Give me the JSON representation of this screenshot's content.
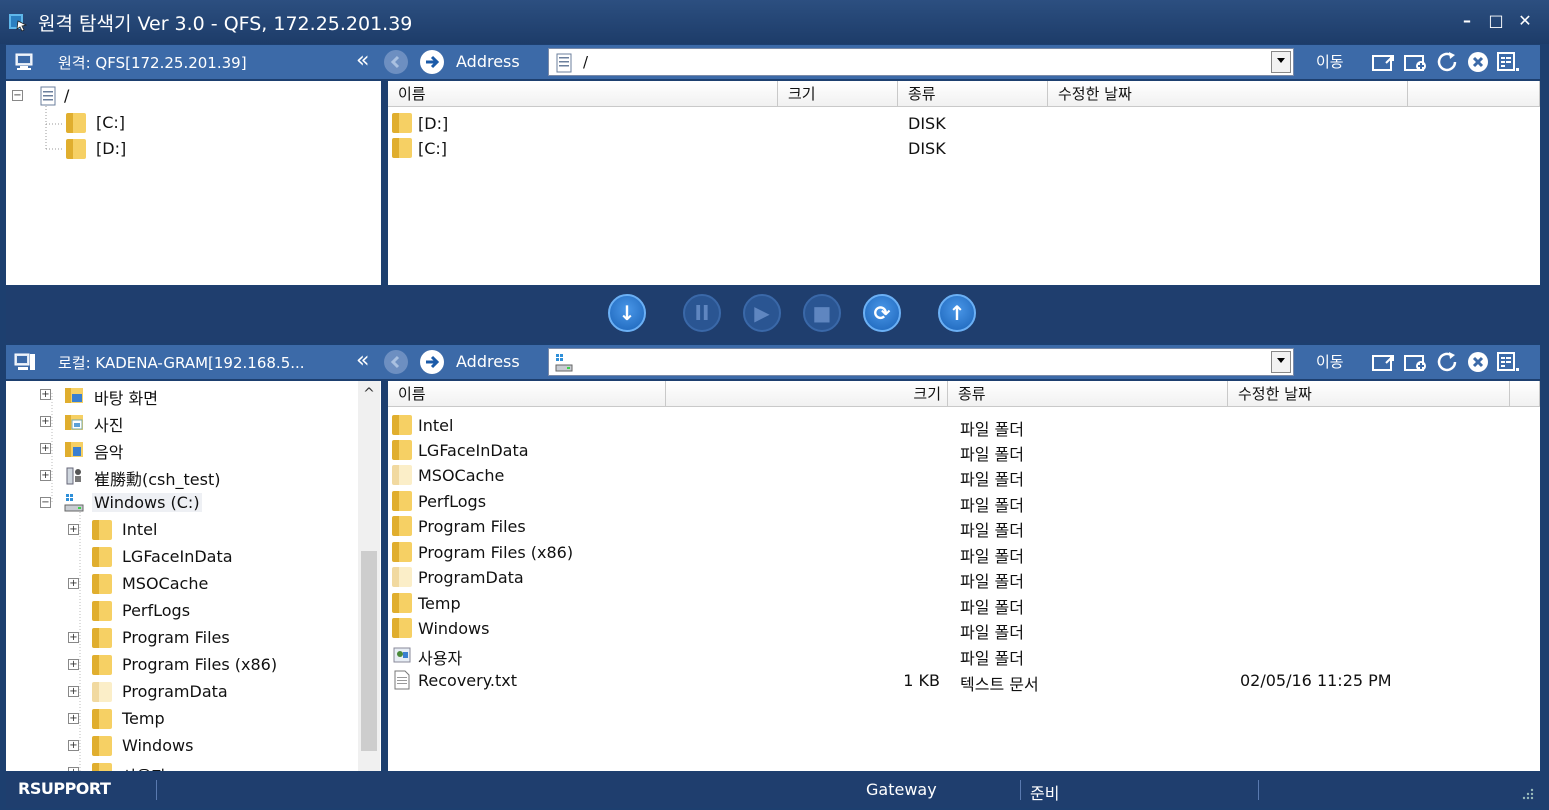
{
  "window": {
    "title": "원격 탐색기 Ver 3.0 - QFS, 172.25.201.39",
    "minimize": "–",
    "maximize": "□",
    "close": "✕"
  },
  "remote": {
    "host_label": "원격: QFS[172.25.201.39]",
    "collapse": "«",
    "address_label": "Address",
    "address_value": "/",
    "go_label": "이동",
    "tree": [
      {
        "label": "/",
        "expander": "−"
      },
      {
        "label": "[C:]"
      },
      {
        "label": "[D:]"
      }
    ],
    "columns": [
      "이름",
      "크기",
      "종류",
      "수정한 날짜"
    ],
    "rows": [
      {
        "name": "[D:]",
        "size": "",
        "type": "DISK",
        "date": ""
      },
      {
        "name": "[C:]",
        "size": "",
        "type": "DISK",
        "date": ""
      }
    ]
  },
  "local": {
    "host_label": "로컬: KADENA-GRAM[192.168.5...",
    "collapse": "«",
    "address_label": "Address",
    "address_value": "",
    "go_label": "이동",
    "tree": [
      {
        "label": "바탕 화면",
        "expander": "+"
      },
      {
        "label": "사진",
        "expander": "+"
      },
      {
        "label": "음악",
        "expander": "+"
      },
      {
        "label": "崔勝勳(csh_test)",
        "expander": "+"
      },
      {
        "label": "Windows (C:)",
        "expander": "−"
      },
      {
        "label": "Intel",
        "expander": "+"
      },
      {
        "label": "LGFaceInData",
        "expander": ""
      },
      {
        "label": "MSOCache",
        "expander": "+"
      },
      {
        "label": "PerfLogs",
        "expander": ""
      },
      {
        "label": "Program Files",
        "expander": "+"
      },
      {
        "label": "Program Files (x86)",
        "expander": "+"
      },
      {
        "label": "ProgramData",
        "expander": "+"
      },
      {
        "label": "Temp",
        "expander": "+"
      },
      {
        "label": "Windows",
        "expander": "+"
      },
      {
        "label": "사용자",
        "expander": "+"
      }
    ],
    "scroll_up": "^",
    "columns": [
      "이름",
      "크기",
      "종류",
      "수정한 날짜"
    ],
    "rows": [
      {
        "name": "Intel",
        "size": "",
        "type": "파일 폴더",
        "date": ""
      },
      {
        "name": "LGFaceInData",
        "size": "",
        "type": "파일 폴더",
        "date": ""
      },
      {
        "name": "MSOCache",
        "size": "",
        "type": "파일 폴더",
        "date": ""
      },
      {
        "name": "PerfLogs",
        "size": "",
        "type": "파일 폴더",
        "date": ""
      },
      {
        "name": "Program Files",
        "size": "",
        "type": "파일 폴더",
        "date": ""
      },
      {
        "name": "Program Files (x86)",
        "size": "",
        "type": "파일 폴더",
        "date": ""
      },
      {
        "name": "ProgramData",
        "size": "",
        "type": "파일 폴더",
        "date": ""
      },
      {
        "name": "Temp",
        "size": "",
        "type": "파일 폴더",
        "date": ""
      },
      {
        "name": "Windows",
        "size": "",
        "type": "파일 폴더",
        "date": ""
      },
      {
        "name": "사용자",
        "size": "",
        "type": "파일 폴더",
        "date": ""
      },
      {
        "name": "Recovery.txt",
        "size": "1 KB",
        "type": "텍스트 문서",
        "date": "02/05/16 11:25 PM"
      }
    ]
  },
  "transfer": {
    "download": "↓",
    "pause": "II",
    "play": "▶",
    "stop": "■",
    "sync": "⟳",
    "upload": "↑"
  },
  "status": {
    "logo": "RSUPPORT",
    "gateway": "Gateway",
    "state": "준비"
  },
  "colors": {
    "frame": "#1d3f6f",
    "pane_header": "#3c6aa8",
    "accent_button": "#1a63b8"
  }
}
